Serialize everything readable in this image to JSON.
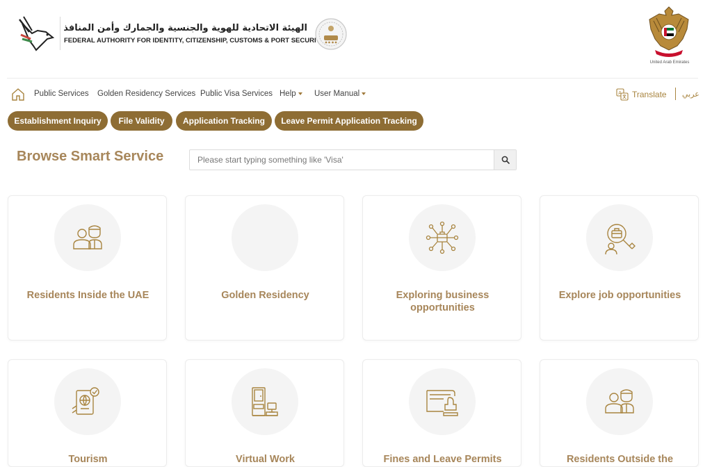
{
  "header": {
    "authority_ar": "الهيئة الاتحادية للهوية والجنسية والجمارك وأمن المنافذ",
    "authority_en": "FEDERAL AUTHORITY FOR IDENTITY, CITIZENSHIP, CUSTOMS & PORT SECURITY",
    "country_label": "United Arab Emirates"
  },
  "nav": {
    "items": [
      "Public Services",
      "Golden Residency Services",
      "Public Visa Services",
      "Help",
      "User Manual"
    ],
    "translate_label": "Translate",
    "arabic_label": "عربي"
  },
  "quick_links": [
    "Establishment Inquiry",
    "File Validity",
    "Application Tracking",
    "Leave Permit Application Tracking"
  ],
  "browse": {
    "title": "Browse Smart Service",
    "search_placeholder": "Please start typing something like 'Visa'"
  },
  "cards": [
    {
      "title": "Residents Inside the UAE",
      "icon": "residents-icon"
    },
    {
      "title": "Golden Residency",
      "icon": ""
    },
    {
      "title": "Exploring business opportunities",
      "icon": "business-network-icon"
    },
    {
      "title": "Explore job opportunities",
      "icon": "job-search-icon"
    },
    {
      "title": "Tourism",
      "icon": "tourism-passport-icon"
    },
    {
      "title": "Virtual Work",
      "icon": "virtual-work-icon"
    },
    {
      "title": "Fines and Leave Permits",
      "icon": "stamp-icon"
    },
    {
      "title": "Residents Outside the",
      "icon": "residents-outside-icon"
    }
  ],
  "colors": {
    "brand_gold": "#8e6d34",
    "title_gold": "#a7865a",
    "icon_stroke": "#a8843f"
  }
}
